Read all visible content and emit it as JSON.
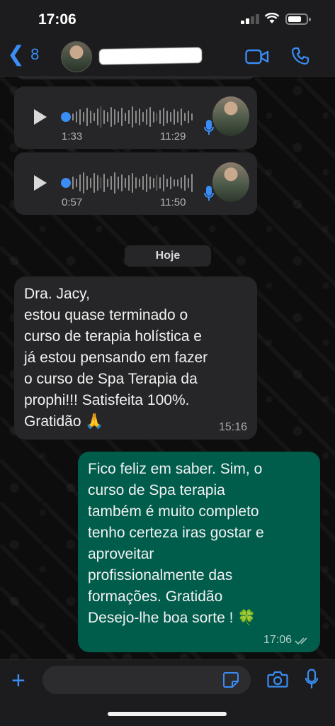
{
  "status_bar": {
    "time": "17:06"
  },
  "header": {
    "back_count": "8",
    "contact_name": "",
    "icons": [
      "back-chevron-icon",
      "avatar",
      "video-call-icon",
      "phone-icon"
    ]
  },
  "voice_messages": [
    {
      "duration": "1:33",
      "time": "11:29"
    },
    {
      "duration": "0:57",
      "time": "11:50"
    }
  ],
  "date_divider": "Hoje",
  "messages": [
    {
      "direction": "incoming",
      "text": "Dra. Jacy,\nestou quase terminado o\ncurso  de terapia holística e\njá estou pensando em fazer\no curso de Spa Terapia da\nprophi!!!  Satisfeita 100%.\nGratidão 🙏",
      "time": "15:16"
    },
    {
      "direction": "outgoing",
      "text": "Fico feliz em saber. Sim, o\ncurso de Spa terapia\ntambém é muito completo\ntenho certeza iras gostar e\naproveitar\nprofissionalmente das\nformações. Gratidão\nDesejo-lhe boa sorte ! 🍀",
      "time": "17:06",
      "status": "read"
    }
  ],
  "composer": {
    "placeholder": ""
  },
  "colors": {
    "accent": "#3a8df5",
    "outgoing_bubble": "#005c4b",
    "incoming_bubble": "#262628"
  }
}
